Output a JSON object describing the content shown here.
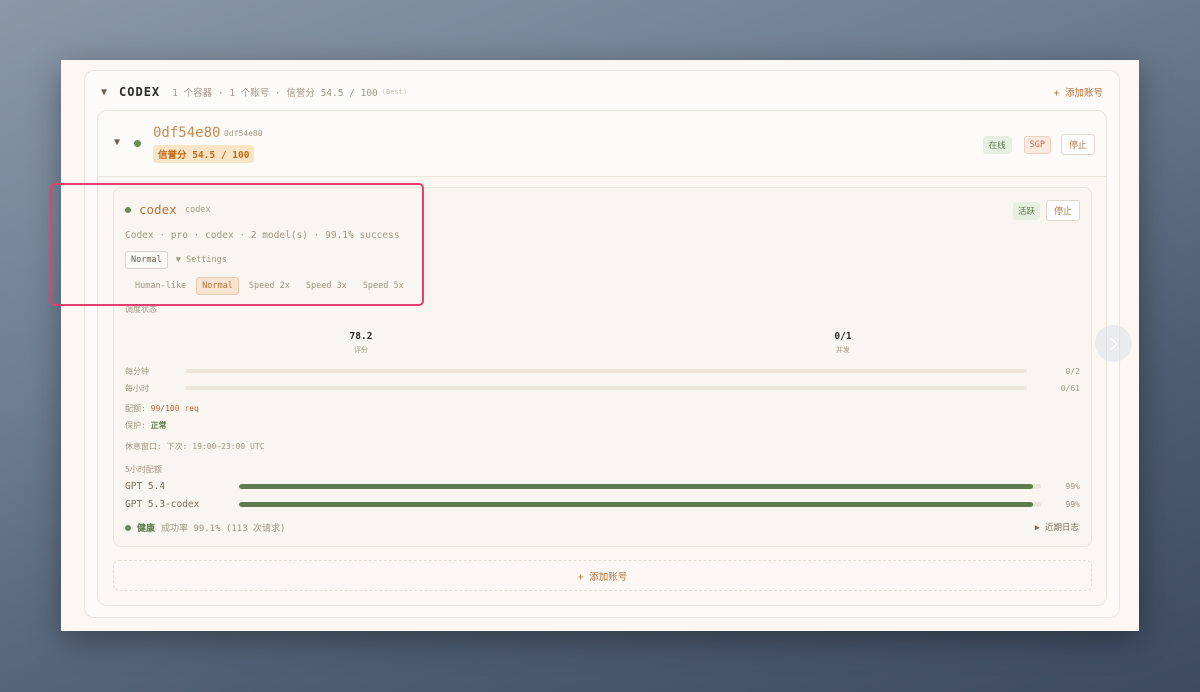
{
  "group": {
    "title": "CODEX",
    "meta": "1 个容器 · 1 个账号 · 信誉分 54.5 / 100",
    "meta_tag": "(Best)",
    "add_label": "+ 添加账号"
  },
  "account": {
    "name": "0df54e80",
    "id": "0df54e80",
    "score": "信誉分 54.5 / 100",
    "status": "在线",
    "region": "SGP",
    "stop_label": "停止"
  },
  "container": {
    "name": "codex",
    "sub": "codex",
    "status": "活跃",
    "stop_label": "停止",
    "info": "Codex · pro · codex · 2 model(s) · 99.1% success",
    "mode_current": "Normal",
    "settings_label": "▼ Settings",
    "modes": [
      "Human-like",
      "Normal",
      "Speed 2x",
      "Speed 3x",
      "Speed 5x"
    ],
    "selected_mode": "Normal"
  },
  "schedule": {
    "title": "调度状态",
    "score_value": "78.2",
    "score_label": "评分",
    "concurrency_value": "0/1",
    "concurrency_label": "并发",
    "per_minute_label": "每分钟",
    "per_minute_value": "0/2",
    "per_hour_label": "每小时",
    "per_hour_value": "0/61",
    "quota_label": "配额:",
    "quota_value": "99/100 req",
    "protect_label": "保护:",
    "protect_value": "正常",
    "rest_window": "休息窗口: 下次: 19:00–23:00 UTC"
  },
  "quota5h": {
    "title": "5小时配额",
    "items": [
      {
        "label": "GPT 5.4",
        "value": "99%",
        "fraction": 0.99
      },
      {
        "label": "GPT 5.3-codex",
        "value": "99%",
        "fraction": 0.99
      }
    ]
  },
  "health": {
    "label": "健康",
    "text": "成功率 99.1% (113 次请求)",
    "logs_label": "▶ 近期日志"
  },
  "add_account_label": "+ 添加账号",
  "colors": {
    "accent": "#b5743a",
    "success": "#5f7c4e",
    "highlight": "#e43f6f"
  }
}
